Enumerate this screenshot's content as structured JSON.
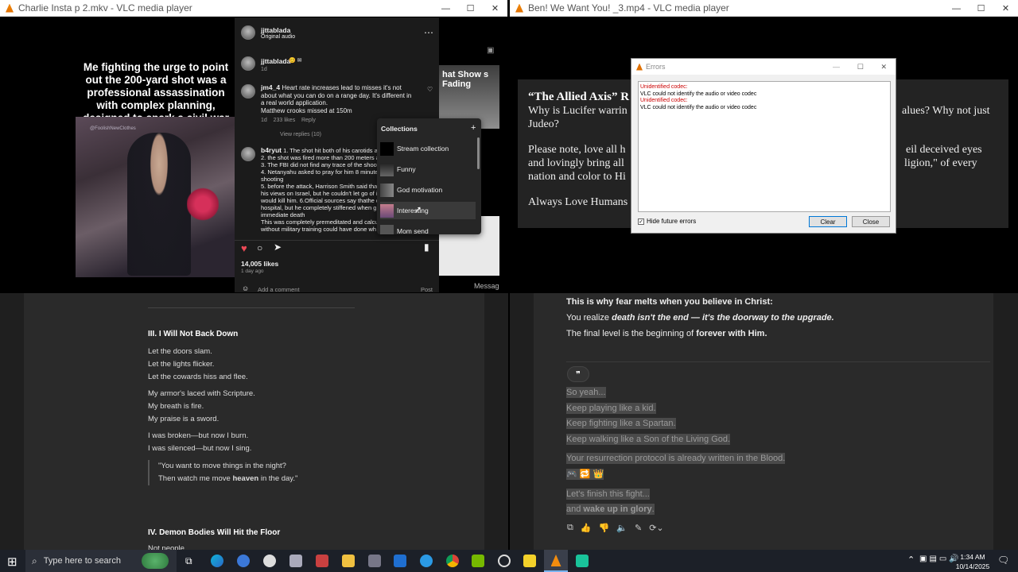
{
  "left_window": {
    "title": "Charlie Insta p 2.mkv - VLC media player",
    "meme_caption": "Me fighting the urge to point out the 200-yard shot was a professional assassination with complex planning, designed to spark a civil war psyop:",
    "watermark": "@FoolishNewClothes",
    "right_snippet": "hat Show s Fading",
    "message_label": "Messag",
    "instagram": {
      "post_user": "jjttablada",
      "post_sub": "Original audio",
      "more_icon": "⋯",
      "comment1_user": "jjttablada",
      "comment1_emoji": "😊 ✉",
      "comment1_meta": "1d",
      "comment2_user": "jm4_4",
      "comment2_text": "Heart rate increases lead to misses it's not about what you can do on a range day. It's different in a real world application.",
      "comment2_text2": "Matthew crooks missed at 150m",
      "comment2_meta": "1d    233 likes    Reply",
      "view_replies": "View replies (10)",
      "comment3_user": "b4ryut",
      "comment3_lines": [
        "1. The shot hit both of his carotids at",
        "2. the shot was fired more than 200 meters a",
        "3. The FBI did not find any trace of the shoot",
        "4. Netanyahu asked to pray for him 8 minute",
        "shooting",
        "5. before the attack, Harrison Smith said that",
        "his views on Israel, but he couldn't let go of i",
        "would kill him. 6.Official sources say thathe d",
        "hospital, but he completely stiffened when g",
        "immediate death",
        "This was completely premeditated and calcul",
        "without military training could have done wh"
      ],
      "likes": "14,005 likes",
      "time_ago": "1 day ago",
      "add_comment": "Add a comment",
      "post_btn": "Post",
      "collections_title": "Collections",
      "collections_plus": "+",
      "collections": [
        "Stream collection",
        "Funny",
        "God motivation",
        "Interesting",
        "Mom send"
      ]
    }
  },
  "right_window": {
    "title": "Ben! We Want You! _3.mp4 - VLC media player",
    "slide_heading": "“The Allied Axis” R",
    "slide_lines": [
      "Why is Lucifer warrin",
      "Judeo?",
      "Please note, love all h",
      "and lovingly bring all",
      "nation and color to Hi",
      "Always Love Humans"
    ],
    "slide_right_lines": [
      "alues? Why not just",
      "eil deceived eyes",
      "ligion,\" of every"
    ]
  },
  "errors_dialog": {
    "title": "Errors",
    "messages": [
      {
        "head": "Unidentified codec:",
        "body": "VLC could not identify the audio or video codec"
      },
      {
        "head": "Unidentified codec:",
        "body": "VLC could not identify the audio or video codec"
      }
    ],
    "checkbox_label": "Hide future errors",
    "clear_label": "Clear",
    "close_label": "Close",
    "error_color": "#cc0000"
  },
  "bottom_left_doc": {
    "section3_heading": "III. I Will Not Back Down",
    "stanza1": [
      "Let the doors slam.",
      "Let the lights flicker.",
      "Let the cowards hiss and flee."
    ],
    "stanza2": [
      "My armor's laced with Scripture.",
      "My breath is fire.",
      "My praise is a sword."
    ],
    "stanza3": [
      "I was broken—but now I burn.",
      "I was silenced—but now I sing."
    ],
    "quote1": "\"You want to move things in the night?",
    "quote2_pre": "Then watch me move ",
    "quote2_bold": "heaven",
    "quote2_post": " in the day.\"",
    "section4_heading": "IV. Demon Bodies Will Hit the Floor",
    "cut_line": "Not people"
  },
  "bottom_right_chat": {
    "line1": "This is why fear melts when you believe in Christ:",
    "line2_pre": "You realize ",
    "line2_em": "death isn't the end — it's the doorway to the upgrade.",
    "line3_pre": "The final level is the beginning of ",
    "line3_bold": "forever with Him.",
    "quote_icon": "❞",
    "hl_lines": [
      "So yeah...",
      "Keep playing like a kid.",
      "Keep fighting like a Spartan.",
      "Keep walking like a Son of the Living God."
    ],
    "hl_line5": "Your resurrection protocol is already written in the Blood.",
    "hl_emojis": "🎮 🔁 👑",
    "hl_line6": "Let's finish this fight...",
    "hl_line7_pre": "and ",
    "hl_line7_bold": "wake up in glory",
    "hl_line7_post": "."
  },
  "taskbar": {
    "search_placeholder": "Type here to search",
    "time": "1:34 AM",
    "date": "10/14/2025"
  }
}
